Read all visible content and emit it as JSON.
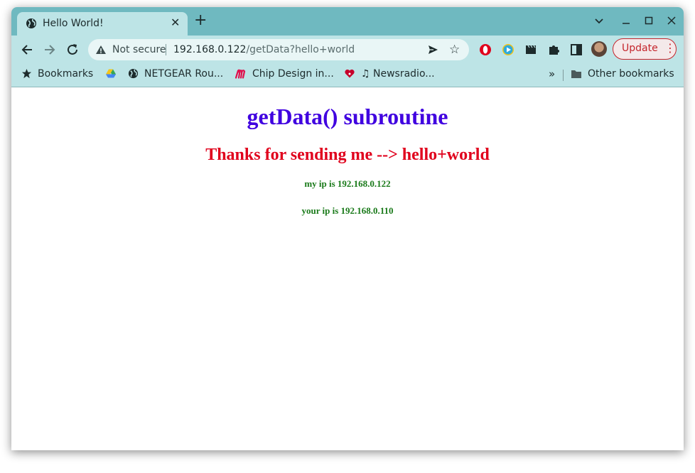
{
  "tab": {
    "title": "Hello World!",
    "close_icon": "close-icon",
    "new_tab_icon": "plus-icon"
  },
  "window_controls": [
    "chevron-down-icon",
    "minimize-icon",
    "maximize-icon",
    "close-icon"
  ],
  "omnibox": {
    "security_label": "Not secure",
    "url_host": "192.168.0.122",
    "url_path": "/getData?hello+world"
  },
  "toolbar": {
    "update_label": "Update"
  },
  "bookmarks": {
    "items": [
      {
        "label": "Bookmarks",
        "icon": "star-icon"
      },
      {
        "label": "",
        "icon": "google-drive-icon"
      },
      {
        "label": "NETGEAR Rou...",
        "icon": "globe-icon"
      },
      {
        "label": "Chip Design in...",
        "icon": "m-logo-icon"
      },
      {
        "label": "♫ Newsradio...",
        "icon": "iheart-icon"
      }
    ],
    "overflow": "»",
    "other": "Other bookmarks"
  },
  "page": {
    "heading": "getData() subroutine",
    "subheading": "Thanks for sending me --> hello+world",
    "my_ip": "my ip is 192.168.0.122",
    "your_ip": "your ip is 192.168.0.110",
    "colors": {
      "heading": "#4000e0",
      "subheading": "#e0001c",
      "ip": "#1a7a1a"
    }
  }
}
